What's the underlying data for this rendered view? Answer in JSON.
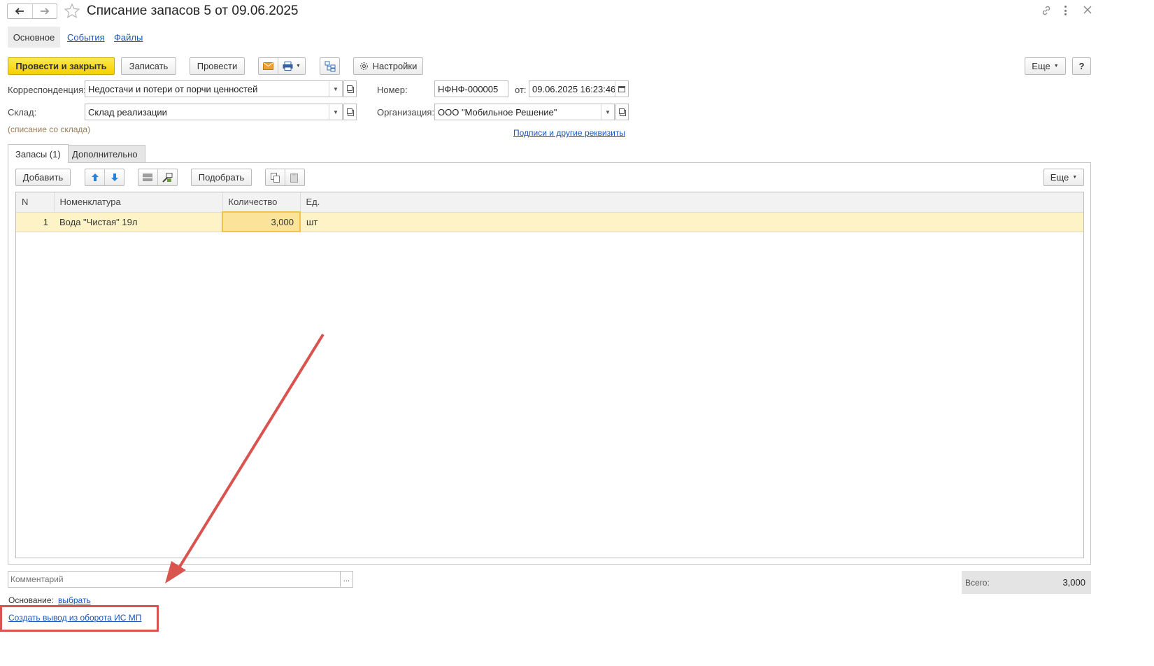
{
  "window": {
    "title": "Списание запасов 5 от 09.06.2025"
  },
  "nav_tabs": [
    "Основное",
    "События",
    "Файлы"
  ],
  "toolbar": {
    "post_close": "Провести и закрыть",
    "save": "Записать",
    "post": "Провести",
    "settings": "Настройки",
    "more": "Еще",
    "help": "?"
  },
  "header_fields": {
    "corr_label": "Корреспонденция:",
    "corr_value": "Недостачи и потери от порчи ценностей",
    "warehouse_label": "Склад:",
    "warehouse_value": "Склад реализации",
    "warehouse_hint": "(списание со склада)",
    "number_label": "Номер:",
    "number_value": "НФНФ-000005",
    "date_label": "от:",
    "date_value": "09.06.2025 16:23:46",
    "org_label": "Организация:",
    "org_value": "ООО \"Мобильное Решение\"",
    "signatures_link": "Подписи и другие реквизиты"
  },
  "content_tabs": [
    "Запасы (1)",
    "Дополнительно"
  ],
  "table_toolbar": {
    "add": "Добавить",
    "pick": "Подобрать",
    "more": "Еще"
  },
  "table": {
    "columns": [
      "N",
      "Номенклатура",
      "Количество",
      "Ед."
    ],
    "rows": [
      {
        "n": "1",
        "name": "Вода \"Чистая\" 19л",
        "qty": "3,000",
        "unit": "шт"
      }
    ]
  },
  "footer": {
    "comment_placeholder": "Комментарий",
    "comment_btn": "...",
    "basis_label": "Основание:",
    "basis_link": "выбрать",
    "create_link": "Создать вывод из оборота ИС МП",
    "total_label": "Всего:",
    "total_value": "3,000"
  },
  "colors": {
    "accent_yellow": "#f5d000",
    "row_highlight": "#fdf3c6",
    "cell_highlight": "#fbe39a",
    "link_blue": "#1a55b8",
    "annotation_red": "#d9534f"
  }
}
